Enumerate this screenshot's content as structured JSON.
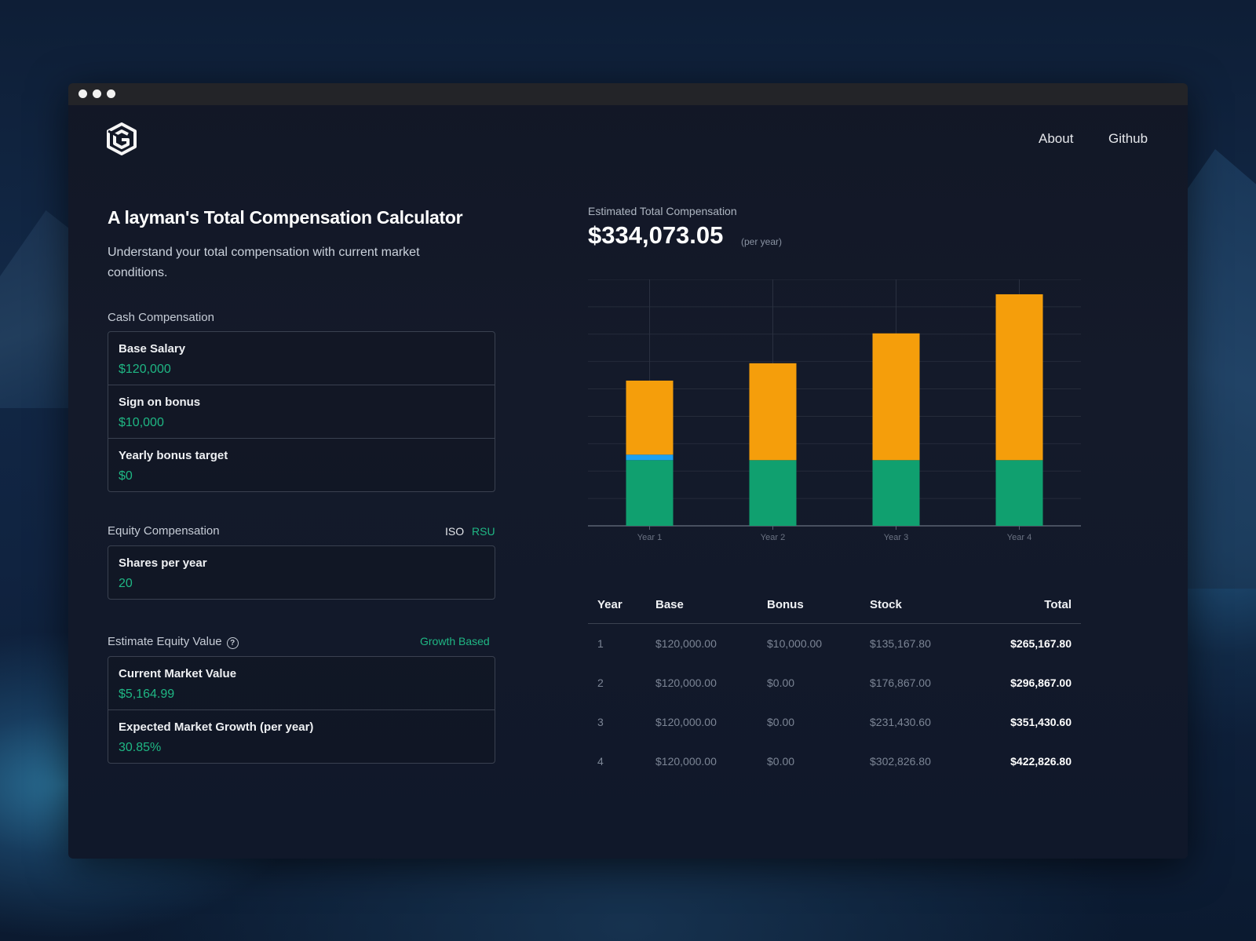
{
  "window": {
    "dots": 3
  },
  "nav": {
    "about": "About",
    "github": "Github"
  },
  "logo": {
    "icon": "hexagon-logo-icon"
  },
  "hero": {
    "title": "A layman's Total Compensation Calculator",
    "subtitle": "Understand your total compensation with current market conditions."
  },
  "cash": {
    "label": "Cash Compensation",
    "fields": [
      {
        "label": "Base Salary",
        "value": "$120,000"
      },
      {
        "label": "Sign on bonus",
        "value": "$10,000"
      },
      {
        "label": "Yearly bonus target",
        "value": "$0"
      }
    ]
  },
  "equity": {
    "label": "Equity Compensation",
    "toggle_iso": "ISO",
    "toggle_rsu": "RSU",
    "selected": "RSU",
    "fields": [
      {
        "label": "Shares per year",
        "value": "20"
      }
    ]
  },
  "estimate": {
    "label": "Estimate Equity Value",
    "help_icon": "question-circle-icon",
    "mode": "Growth Based",
    "fields": [
      {
        "label": "Current Market Value",
        "value": "$5,164.99"
      },
      {
        "label": "Expected Market Growth (per year)",
        "value": "30.85%"
      }
    ]
  },
  "summary": {
    "label": "Estimated Total Compensation",
    "value": "$334,073.05",
    "unit": "(per year)"
  },
  "colors": {
    "base": "#10a06f",
    "bonus": "#1da1f2",
    "stock": "#f59e0b",
    "accent": "#1fb784"
  },
  "chart_data": {
    "type": "bar",
    "stacked": true,
    "categories": [
      "Year 1",
      "Year 2",
      "Year 3",
      "Year 4"
    ],
    "series": [
      {
        "key": "base",
        "values": [
          120000,
          120000,
          120000,
          120000
        ]
      },
      {
        "key": "bonus",
        "values": [
          10000,
          0,
          0,
          0
        ]
      },
      {
        "key": "stock",
        "values": [
          135167.8,
          176867.0,
          231430.6,
          302826.8
        ]
      }
    ],
    "ylim": [
      0,
      450000
    ],
    "grid": true
  },
  "table": {
    "headers": [
      "Year",
      "Base",
      "Bonus",
      "Stock",
      "Total"
    ],
    "rows": [
      [
        "1",
        "$120,000.00",
        "$10,000.00",
        "$135,167.80",
        "$265,167.80"
      ],
      [
        "2",
        "$120,000.00",
        "$0.00",
        "$176,867.00",
        "$296,867.00"
      ],
      [
        "3",
        "$120,000.00",
        "$0.00",
        "$231,430.60",
        "$351,430.60"
      ],
      [
        "4",
        "$120,000.00",
        "$0.00",
        "$302,826.80",
        "$422,826.80"
      ]
    ]
  }
}
